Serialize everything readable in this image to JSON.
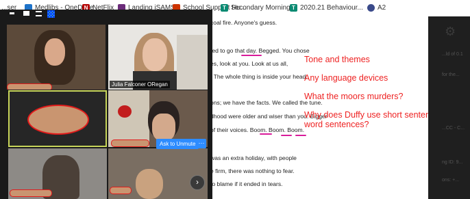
{
  "bookmarks": [
    {
      "label": "...ser",
      "icon": "app-icon",
      "color": "#555555"
    },
    {
      "label": "Medlibs - OneDrive",
      "icon": "onedrive-icon",
      "color": "#1e73c9"
    },
    {
      "label": "NetFlix",
      "icon": "netflix-icon",
      "color": "#b30000"
    },
    {
      "label": "Landing iSAMS",
      "icon": "isams-icon",
      "color": "#6b2c7a"
    },
    {
      "label": "School Support Hu...",
      "icon": "bookmark-icon",
      "color": "#cc3300"
    },
    {
      "label": "Secondary Morning...",
      "icon": "teams-icon",
      "color": "#0a8a72"
    },
    {
      "label": "2020.21 Behaviour...",
      "icon": "teams-icon",
      "color": "#0a8a72"
    },
    {
      "label": "A2",
      "icon": "a2-icon",
      "color": "#3a4a8a"
    }
  ],
  "document": {
    "lines": [
      "coal fire. Anyone's guess.",
      "ted to go that day. Begged. You chose",
      "es, look at you. Look at us all,",
      ". The whole thing is inside your head.",
      "ons; we have the facts. We called the tune.",
      "dhood were older and wiser than you. Bigger",
      "of their voices. Boom. Boom. Boom.",
      "was an extra holiday, with people",
      "e firm, there was nothing to fear.",
      "to blame if it ended in tears."
    ]
  },
  "annotations": [
    "Tone and themes",
    "Any language devices",
    "What the moors murders?",
    "Why does Duffy use short sentences/one",
    "word sentences?"
  ],
  "right_panel": {
    "lines": [
      "...ld of 0.1",
      "for the...",
      "...CC - C...",
      "ng ID: 9...",
      "ons: +..."
    ]
  },
  "zoom": {
    "participant_name": "Julia Falconer ORegan",
    "unmute_label": "Ask to Unmute",
    "more_label": "···",
    "next_label": "›"
  },
  "colors": {
    "annotation_red": "#ee2222",
    "zoom_blue": "#2d8cff",
    "redaction_fill": "#c99570",
    "redaction_outline": "#e21b1b",
    "highlight_magenta": "#d91c9a"
  }
}
